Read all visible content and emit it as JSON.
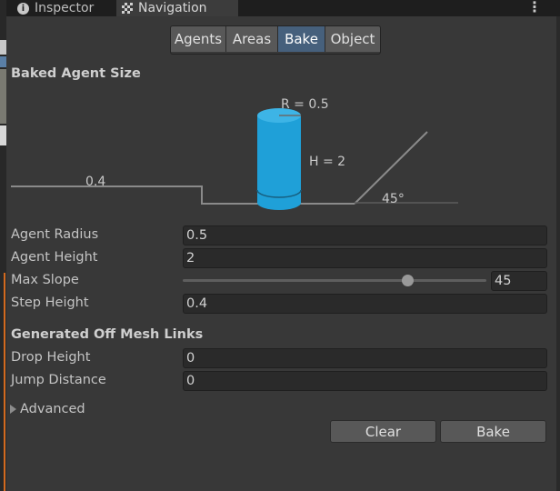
{
  "tabs": [
    {
      "label": "Inspector",
      "icon": "info-icon"
    },
    {
      "label": "Navigation",
      "icon": "navigation-icon",
      "active": true
    }
  ],
  "toolbar": {
    "segments": [
      "Agents",
      "Areas",
      "Bake",
      "Object"
    ],
    "active": "Bake"
  },
  "baked_agent_size": {
    "title": "Baked Agent Size",
    "diagram": {
      "radius_label": "R = 0.5",
      "height_label": "H = 2",
      "step_label": "0.4",
      "slope_label": "45°"
    }
  },
  "fields": {
    "agent_radius": {
      "label": "Agent Radius",
      "value": "0.5"
    },
    "agent_height": {
      "label": "Agent Height",
      "value": "2"
    },
    "max_slope": {
      "label": "Max Slope",
      "value": "45",
      "slider_fraction": 0.74
    },
    "step_height": {
      "label": "Step Height",
      "value": "0.4"
    }
  },
  "off_mesh": {
    "title": "Generated Off Mesh Links",
    "drop_height": {
      "label": "Drop Height",
      "value": "0"
    },
    "jump_distance": {
      "label": "Jump Distance",
      "value": "0"
    }
  },
  "advanced": {
    "label": "Advanced"
  },
  "buttons": {
    "clear": "Clear",
    "bake": "Bake"
  },
  "colors": {
    "background": "#383838",
    "active_segment": "#46607c",
    "cylinder": "#1fa0d8",
    "field_bg": "#2a2a2a"
  }
}
